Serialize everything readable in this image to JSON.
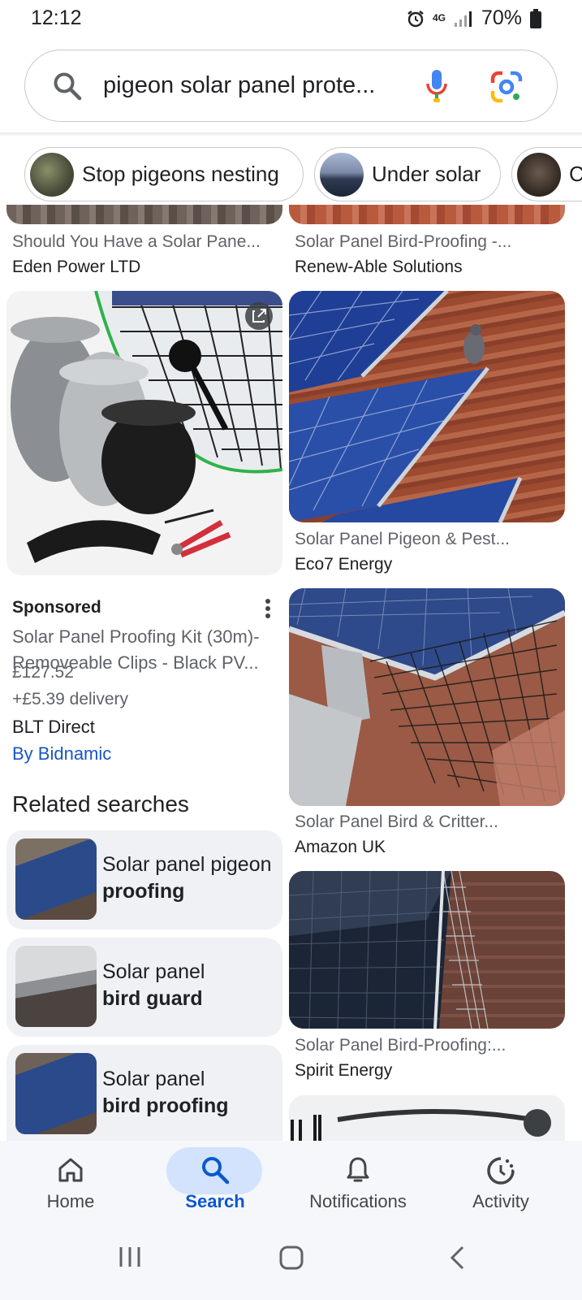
{
  "status_bar": {
    "time": "12:12",
    "network": "4G",
    "battery": "70%"
  },
  "search": {
    "query": "pigeon solar panel prote..."
  },
  "chips": [
    {
      "label": "Stop pigeons nesting"
    },
    {
      "label": "Under solar"
    },
    {
      "label": "C"
    }
  ],
  "results": {
    "top_left": {
      "title": "Should You Have a Solar Pane...",
      "source": "Eden Power LTD"
    },
    "top_right": {
      "title": "Solar Panel Bird-Proofing -...",
      "source": "Renew-Able Solutions"
    },
    "right_2": {
      "title": "Solar Panel Pigeon & Pest...",
      "source": "Eco7 Energy"
    },
    "right_3": {
      "title": "Solar Panel Bird & Critter...",
      "source": "Amazon UK"
    },
    "right_4": {
      "title": "Solar Panel Bird-Proofing:...",
      "source": "Spirit Energy"
    }
  },
  "ad": {
    "label": "Sponsored",
    "title": "Solar Panel Proofing Kit (30m)- Removeable Clips - Black PV...",
    "price": "£127.52",
    "delivery": "+£5.39 delivery",
    "merchant": "BLT Direct",
    "by": "By Bidnamic"
  },
  "related": {
    "heading": "Related searches",
    "items": [
      {
        "plain": "Solar panel pigeon",
        "bold": "proofing"
      },
      {
        "plain": "Solar panel",
        "bold": "bird guard"
      },
      {
        "plain": "Solar panel",
        "bold": "bird proofing"
      }
    ]
  },
  "bottom_nav": [
    {
      "label": "Home",
      "icon": "home-icon"
    },
    {
      "label": "Search",
      "icon": "search-icon",
      "active": true
    },
    {
      "label": "Notifications",
      "icon": "bell-icon"
    },
    {
      "label": "Activity",
      "icon": "activity-icon"
    }
  ],
  "colors": {
    "accent": "#0b57d0",
    "active_pill": "#d3e3fd",
    "link": "#1a56c4"
  }
}
